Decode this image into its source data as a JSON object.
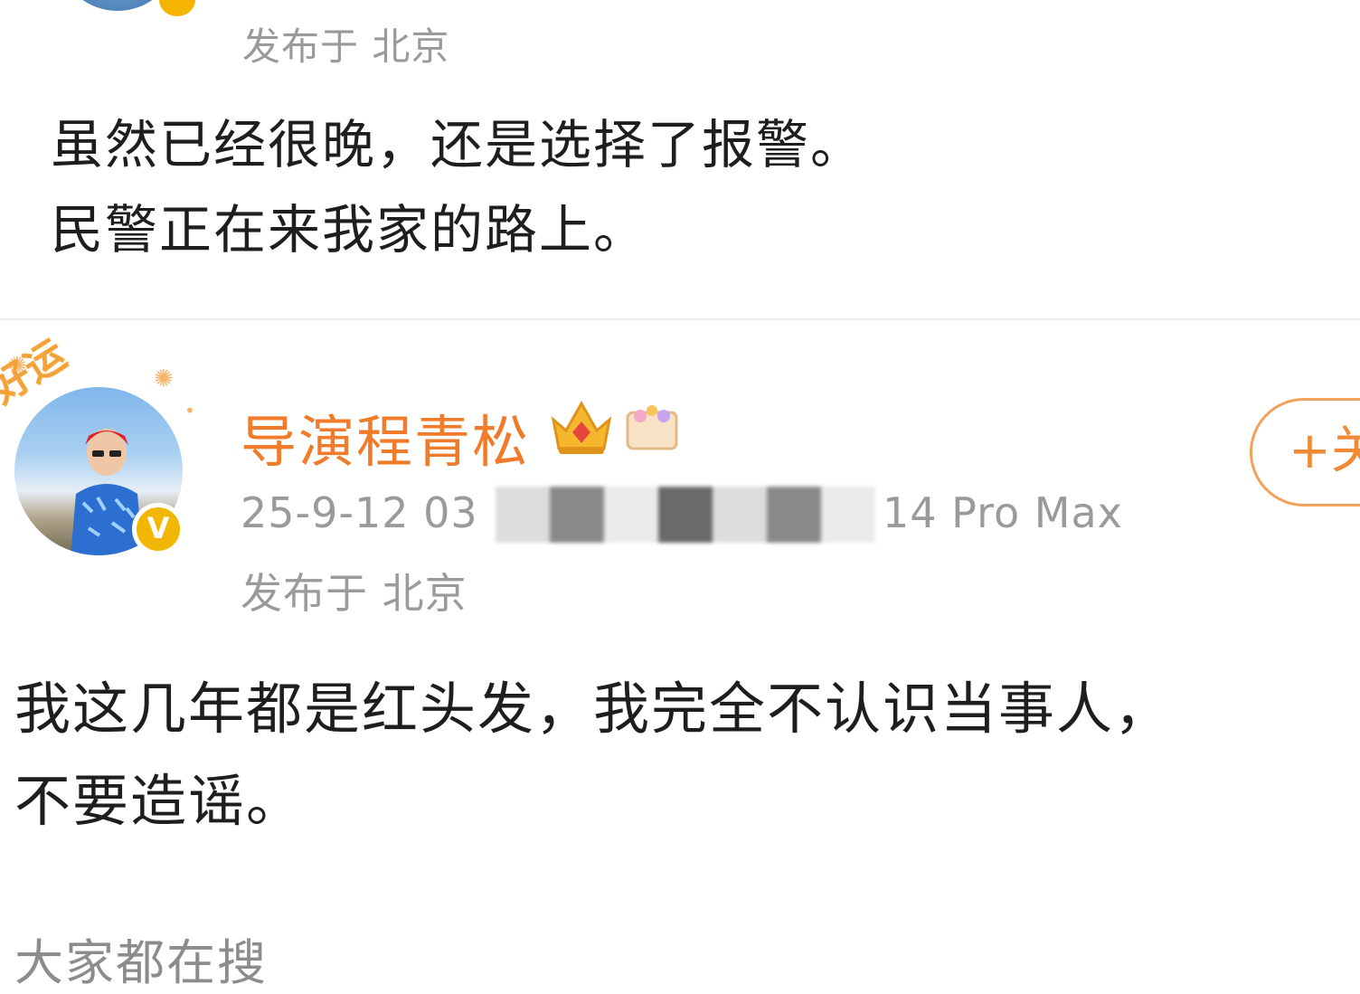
{
  "prev_post": {
    "location": "发布于 北京",
    "text_lines": [
      "虽然已经很晚，还是选择了报警。",
      "民警正在来我家的路上。"
    ]
  },
  "post": {
    "author": "导演程青松",
    "frame_tag": "好运",
    "verified_badge": "V",
    "follow_label": "+关",
    "time_device_left": "25-9-12 03",
    "time_device_right": "14 Pro Max",
    "location": "发布于 北京",
    "text_lines": [
      "我这几年都是红头发，我完全不认识当事人，",
      "不要造谣。"
    ]
  },
  "trending": {
    "label": "大家都在搜"
  },
  "colors": {
    "username": "#f07b2a",
    "meta_gray": "#9a9a9a",
    "follow_border": "#f3a15a",
    "verified_gold": "#f2b705"
  },
  "icons": [
    "crown-icon",
    "card-icon",
    "verified-badge-icon",
    "avatar-frame-icon"
  ]
}
